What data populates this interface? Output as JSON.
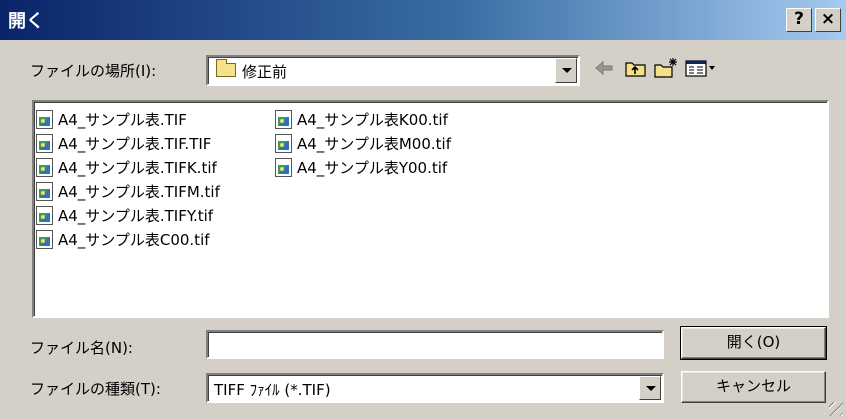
{
  "window": {
    "title": "開く",
    "help_label": "?",
    "close_label": "×"
  },
  "look_in": {
    "label": "ファイルの場所(I):",
    "value": "修正前"
  },
  "toolbar": {
    "icons": [
      "back-arrow-icon",
      "up-folder-icon",
      "new-folder-icon",
      "view-menu-icon"
    ]
  },
  "files": [
    "A4_サンプル表.TIF",
    "A4_サンプル表.TIF.TIF",
    "A4_サンプル表.TIFK.tif",
    "A4_サンプル表.TIFM.tif",
    "A4_サンプル表.TIFY.tif",
    "A4_サンプル表C00.tif",
    "A4_サンプル表K00.tif",
    "A4_サンプル表M00.tif",
    "A4_サンプル表Y00.tif"
  ],
  "filename": {
    "label": "ファイル名(N):",
    "value": ""
  },
  "filetype": {
    "label": "ファイルの種類(T):",
    "value": "TIFF ﾌｧｲﾙ (*.TIF)"
  },
  "buttons": {
    "open": "開く(O)",
    "cancel": "キャンセル"
  }
}
